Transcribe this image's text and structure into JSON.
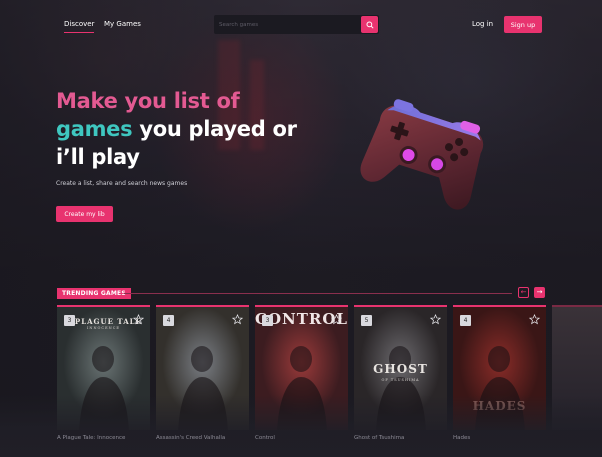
{
  "nav": {
    "links": [
      "Discover",
      "My Games"
    ],
    "search_placeholder": "Search games",
    "login": "Log in",
    "signup": "Sign up"
  },
  "hero": {
    "line1": "Make you list of",
    "line2_accent": "games",
    "line2_rest": " you played or",
    "line3": "i’ll play",
    "subtitle": "Create a list, share and search news games",
    "cta": "Create my lib"
  },
  "trending": {
    "label": "TRENDING GAMES",
    "cards": [
      {
        "rank": "3",
        "title": "A Plague Tale: Innocence",
        "art_text": "A PLAGUE TALE",
        "art_sub": "INNOCENCE",
        "colors": [
          "#6a7474",
          "#2a2f30"
        ]
      },
      {
        "rank": "4",
        "title": "Assassin's Creed Valhalla",
        "art_text": "",
        "art_sub": "",
        "colors": [
          "#7a7e84",
          "#33302c"
        ]
      },
      {
        "rank": "3",
        "title": "Control",
        "art_text": "CONTROL",
        "art_sub": "",
        "colors": [
          "#9a3a3a",
          "#3c1c20"
        ]
      },
      {
        "rank": "5",
        "title": "Ghost of Tsushima",
        "art_text": "GHOST",
        "art_sub": "OF TSUSHIMA",
        "colors": [
          "#6c6a6e",
          "#2a2628"
        ]
      },
      {
        "rank": "4",
        "title": "Hades",
        "art_text": "HADES",
        "art_sub": "",
        "colors": [
          "#8a2c28",
          "#3a1616"
        ]
      }
    ]
  },
  "colors": {
    "accent": "#e8336f",
    "pink": "#e35a92",
    "teal": "#3fc7c0"
  },
  "icons": {
    "search": "search-icon",
    "star": "star-outline-icon",
    "prev": "chevron-left-icon",
    "next": "chevron-right-icon"
  }
}
